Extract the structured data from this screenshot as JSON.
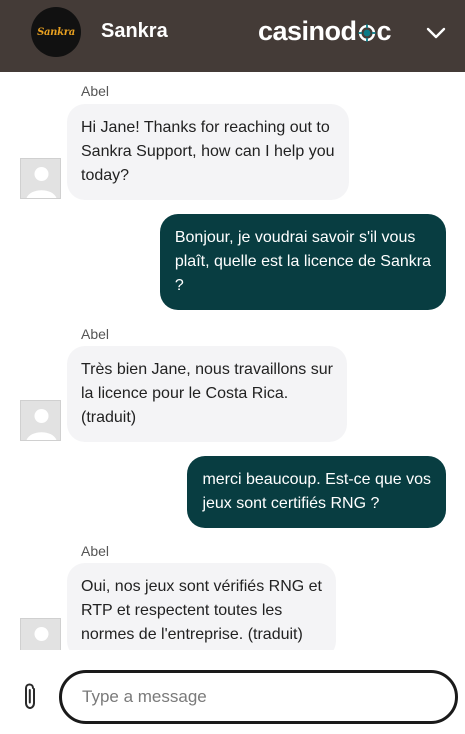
{
  "header": {
    "logo_text": "Sankra",
    "brand_name": "Sankra",
    "partner_logo_left": "casinod",
    "partner_logo_right": "c",
    "background": "#443b37",
    "icons": {
      "chip": "poker-chip-icon",
      "menu": "chevron-down-icon"
    }
  },
  "messages": [
    {
      "from": "agent",
      "sender": "Abel",
      "lines": [
        "Hi Jane! Thanks for reaching out to",
        "Sankra Support, how can I help you",
        "today?"
      ]
    },
    {
      "from": "user",
      "lines": [
        "Bonjour, je voudrai savoir s'il vous",
        "plaît, quelle est la licence de Sankra",
        "?"
      ]
    },
    {
      "from": "agent",
      "sender": "Abel",
      "lines": [
        "Très bien Jane, nous travaillons sur",
        "la licence pour le Costa Rica.",
        "(traduit)"
      ]
    },
    {
      "from": "user",
      "lines": [
        "merci beaucoup. Est-ce que vos",
        "jeux sont certifiés RNG ?"
      ]
    },
    {
      "from": "agent",
      "sender": "Abel",
      "lines": [
        "Oui, nos jeux sont vérifiés RNG et",
        "RTP et respectent toutes les",
        "normes de l'entreprise. (traduit)"
      ]
    }
  ],
  "composer": {
    "placeholder": "Type a message",
    "attach_icon": "paperclip-icon"
  },
  "colors": {
    "header_bg": "#443b37",
    "user_bubble": "#083d41",
    "agent_bubble": "#f4f4f6"
  }
}
